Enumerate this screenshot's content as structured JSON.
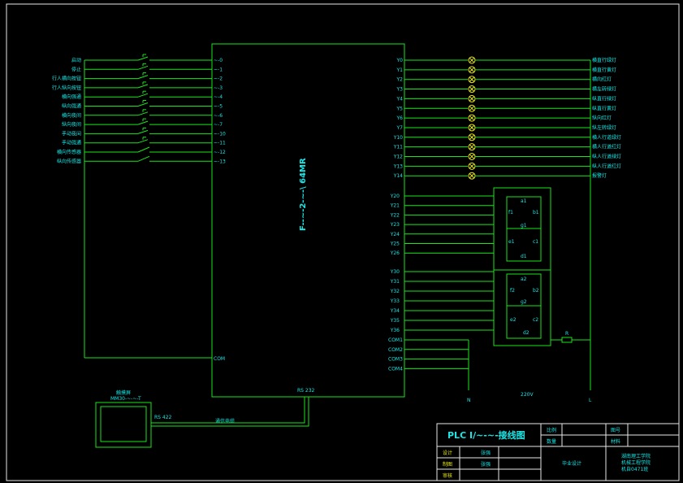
{
  "colors": {
    "background": "#000000",
    "wire": "#19e619",
    "label": "#19e6e6",
    "border": "#e8e8e8",
    "lamp": "#e6e619"
  },
  "plc": {
    "model": "F--~-2-~-\\ 64MR",
    "com_label": "COM",
    "rs_port": "RS 232"
  },
  "inputs": [
    {
      "name": "启动",
      "terminal": "0"
    },
    {
      "name": "停止",
      "terminal": "1"
    },
    {
      "name": "行人横向按钮",
      "terminal": "2"
    },
    {
      "name": "行人纵向按钮",
      "terminal": "3"
    },
    {
      "name": "横向强通",
      "terminal": "4"
    },
    {
      "name": "纵向强通",
      "terminal": "5"
    },
    {
      "name": "横向夜间",
      "terminal": "6"
    },
    {
      "name": "纵向夜间",
      "terminal": "7"
    },
    {
      "name": "手动夜间",
      "terminal": "10"
    },
    {
      "name": "手动强通",
      "terminal": "11"
    },
    {
      "name": "横向传感器",
      "terminal": "12"
    },
    {
      "name": "纵向传感器",
      "terminal": "13"
    }
  ],
  "outputs": [
    {
      "terminal": "Y0",
      "lamp": "横直行绿灯"
    },
    {
      "terminal": "Y1",
      "lamp": "横直行黄灯"
    },
    {
      "terminal": "Y2",
      "lamp": "横向红灯"
    },
    {
      "terminal": "Y3",
      "lamp": "横左转绿灯"
    },
    {
      "terminal": "Y4",
      "lamp": "纵直行绿灯"
    },
    {
      "terminal": "Y5",
      "lamp": "纵直行黄灯"
    },
    {
      "terminal": "Y6",
      "lamp": "纵向红灯"
    },
    {
      "terminal": "Y7",
      "lamp": "纵左转绿灯"
    },
    {
      "terminal": "Y10",
      "lamp": "横人行道绿灯"
    },
    {
      "terminal": "Y11",
      "lamp": "横人行道红灯"
    },
    {
      "terminal": "Y12",
      "lamp": "纵人行道绿灯"
    },
    {
      "terminal": "Y13",
      "lamp": "纵人行道红灯"
    },
    {
      "terminal": "Y14",
      "lamp": "报警灯"
    }
  ],
  "segment_outputs_1": [
    "Y20",
    "Y21",
    "Y22",
    "Y23",
    "Y24",
    "Y25",
    "Y26"
  ],
  "segment_outputs_2": [
    "Y30",
    "Y31",
    "Y32",
    "Y33",
    "Y34",
    "Y35",
    "Y36"
  ],
  "commons": [
    "COM1",
    "COM2",
    "COM3",
    "COM4"
  ],
  "display1": {
    "top": "a1",
    "upper_left": "f1",
    "upper_right": "b1",
    "middle": "g1",
    "lower_left": "e1",
    "lower_right": "c1",
    "bottom": "d1"
  },
  "display2": {
    "top": "a2",
    "upper_left": "f2",
    "upper_right": "b2",
    "middle": "g2",
    "lower_left": "e2",
    "lower_right": "c2",
    "bottom": "d2"
  },
  "resistor_label": "R",
  "power": {
    "neutral": "N",
    "live": "L",
    "voltage": "220V"
  },
  "touchscreen": {
    "title": "触摸屏",
    "model": "MM30-~-~-T",
    "port": "RS 422",
    "cable": "通信电缆"
  },
  "title_block": {
    "drawing_title": "PLC I/~-~-接线图",
    "scale_label": "比例",
    "quantity_label": "数量",
    "sheet_label": "图号",
    "material_label": "材料",
    "designer_label": "设计",
    "designer": "张强",
    "drafter_label": "制图",
    "drafter": "张强",
    "reviewer_label": "审核",
    "project": "毕业设计",
    "school_1": "湖南理工学院",
    "school_2": "机械工程学院",
    "school_3": "机自0471班"
  }
}
